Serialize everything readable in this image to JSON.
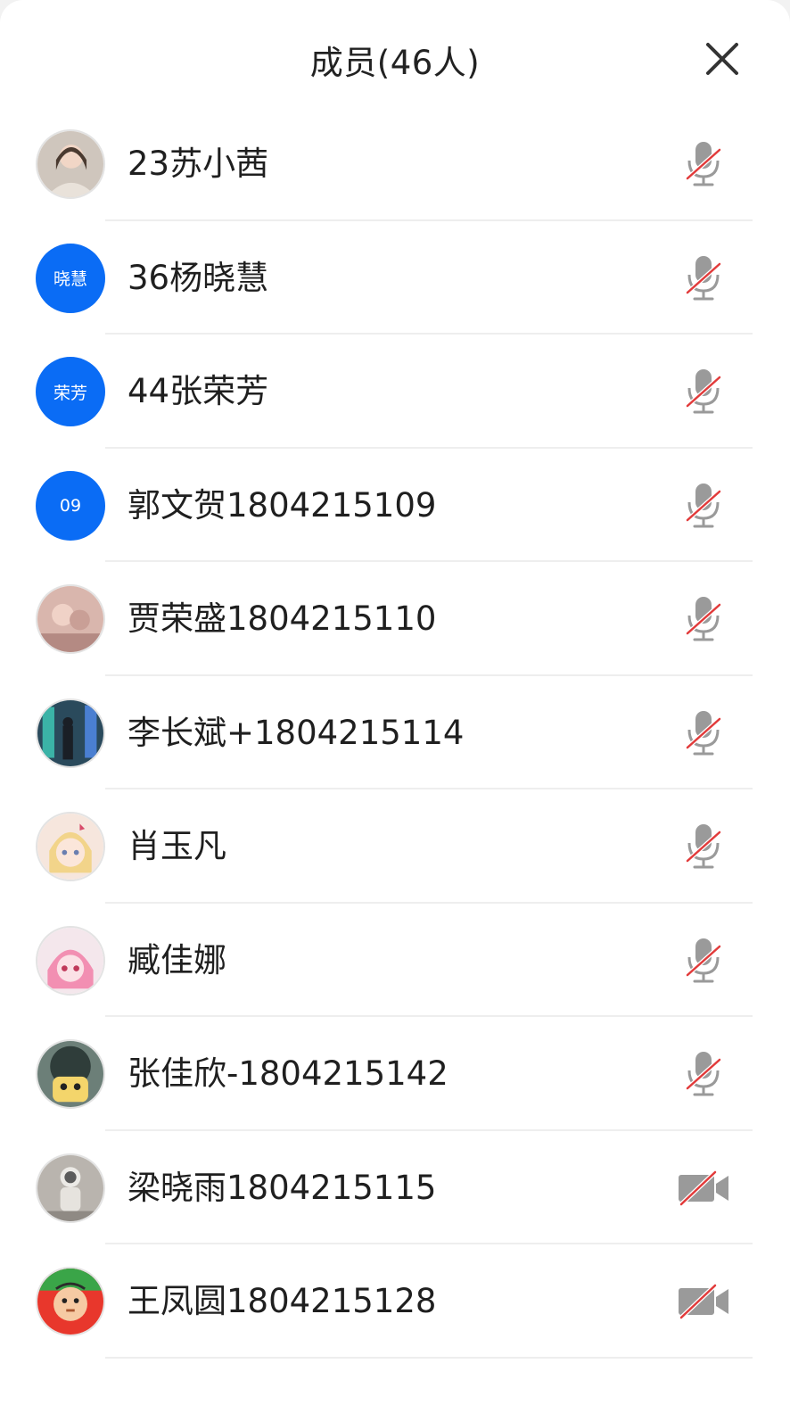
{
  "panel": {
    "title": "成员(46人)"
  },
  "colors": {
    "accent": "#0a6cf5",
    "muted_icon": "#9a9a9a",
    "mute_slash": "#e23b3b"
  },
  "members": [
    {
      "name": "23苏小茜",
      "avatar": {
        "type": "photo"
      },
      "status_icon": "mic-muted-icon"
    },
    {
      "name": "36杨晓慧",
      "avatar": {
        "type": "initials",
        "text": "晓慧"
      },
      "status_icon": "mic-muted-icon"
    },
    {
      "name": "44张荣芳",
      "avatar": {
        "type": "initials",
        "text": "荣芳"
      },
      "status_icon": "mic-muted-icon"
    },
    {
      "name": "郭文贺1804215109",
      "avatar": {
        "type": "initials",
        "text": "09"
      },
      "status_icon": "mic-muted-icon"
    },
    {
      "name": "贾荣盛1804215110",
      "avatar": {
        "type": "photo"
      },
      "status_icon": "mic-muted-icon"
    },
    {
      "name": "李长斌+1804215114",
      "avatar": {
        "type": "photo"
      },
      "status_icon": "mic-muted-icon"
    },
    {
      "name": "肖玉凡",
      "avatar": {
        "type": "photo"
      },
      "status_icon": "mic-muted-icon"
    },
    {
      "name": "臧佳娜",
      "avatar": {
        "type": "photo"
      },
      "status_icon": "mic-muted-icon"
    },
    {
      "name": "张佳欣-1804215142",
      "avatar": {
        "type": "photo"
      },
      "status_icon": "mic-muted-icon"
    },
    {
      "name": "梁晓雨1804215115",
      "avatar": {
        "type": "photo"
      },
      "status_icon": "video-off-icon"
    },
    {
      "name": "王凤圆1804215128",
      "avatar": {
        "type": "photo"
      },
      "status_icon": "video-off-icon"
    }
  ]
}
